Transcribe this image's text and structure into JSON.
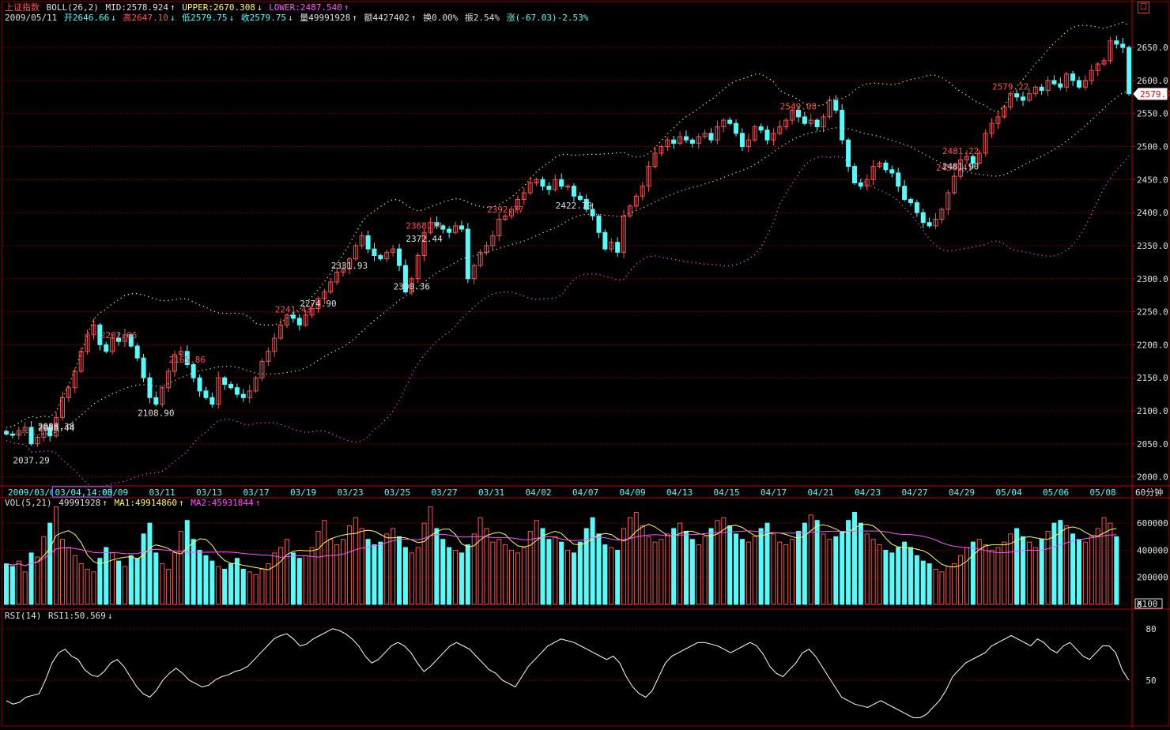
{
  "header": {
    "index_name": "上证指数",
    "indicator": "BOLL(26,2)",
    "mid": "MID:2578.924",
    "upper": "UPPER:2670.308",
    "lower": "LOWER:2487.540",
    "date": "2009/05/11",
    "open": "开2646.66",
    "high": "高2647.10",
    "low": "低2579.75",
    "close": "收2579.75",
    "volume": "量49991928",
    "amount": "额4427402",
    "turnover": "换0.00%",
    "amplitude": "振2.54%",
    "change": "涨(-67.03)-2.53%",
    "icon": "restore-icon"
  },
  "price_panel": {
    "y_ticks": [
      "2650.0",
      "2600.0",
      "2550.0",
      "2500.0",
      "2450.0",
      "2400.0",
      "2350.0",
      "2300.0",
      "2250.0",
      "2200.0",
      "2150.0",
      "2100.0",
      "2050.0",
      "2000.0"
    ],
    "last_price_tag": "2579.7",
    "period": "60分钟"
  },
  "x_axis": {
    "labels": [
      "2009/03/02",
      "03/04,14:00",
      "03/09",
      "03/11",
      "03/13",
      "03/17",
      "03/19",
      "03/23",
      "03/25",
      "03/27",
      "03/31",
      "04/02",
      "04/07",
      "04/09",
      "04/13",
      "04/15",
      "04/17",
      "04/21",
      "04/23",
      "04/27",
      "04/29",
      "05/04",
      "05/06",
      "05/08"
    ]
  },
  "volume_panel": {
    "name": "VOL(5,21)",
    "value": "49991928",
    "ma1": "MA1:49914860",
    "ma2": "MA2:45931844",
    "y_ticks": [
      "600000",
      "400000",
      "200000",
      "0"
    ],
    "unit": "X100"
  },
  "rsi_panel": {
    "name": "RSI(14)",
    "value": "RSI1:50.569",
    "y_ticks": [
      "80",
      "50"
    ]
  },
  "colors": {
    "up": "#ff5050",
    "down": "#54fcfc",
    "upper": "#ffff54",
    "mid": "#e0e0e0",
    "lower": "#ff54ff",
    "grid": "#8b0000",
    "rsi": "#ffffff"
  },
  "chart_data": [
    {
      "type": "candlestick",
      "title": "上证指数 60分钟",
      "annotations": [
        {
          "text": "2037.29",
          "kind": "low",
          "value": 2037.29
        },
        {
          "text": "2241.43",
          "kind": "high",
          "value": 2241.43
        },
        {
          "text": "2088.38",
          "kind": "low",
          "value": 2088.38
        },
        {
          "text": "2202.66",
          "kind": "high",
          "value": 2202.66
        },
        {
          "text": "2086.44",
          "kind": "low",
          "value": 2086.44
        },
        {
          "text": "2165.86",
          "kind": "high",
          "value": 2165.86
        },
        {
          "text": "2108.90",
          "kind": "low",
          "value": 2108.9
        },
        {
          "text": "2368.74",
          "kind": "high",
          "value": 2368.74
        },
        {
          "text": "2274.90",
          "kind": "low",
          "value": 2274.9
        },
        {
          "text": "2392.77",
          "kind": "high",
          "value": 2392.77
        },
        {
          "text": "2300.36",
          "kind": "low",
          "value": 2300.36
        },
        {
          "text": "2456.41",
          "kind": "high",
          "value": 2456.41
        },
        {
          "text": "2331.93",
          "kind": "low",
          "value": 2331.93
        },
        {
          "text": "2549.08",
          "kind": "high",
          "value": 2549.08
        },
        {
          "text": "2481.90",
          "kind": "low",
          "value": 2481.9
        },
        {
          "text": "2579.22",
          "kind": "high",
          "value": 2579.22
        },
        {
          "text": "2422.79",
          "kind": "low",
          "value": 2422.79
        },
        {
          "text": "2481.22",
          "kind": "high",
          "value": 2481.22
        },
        {
          "text": "2372.44",
          "kind": "low",
          "value": 2372.44
        }
      ],
      "close_path": [
        2065,
        2063,
        2070,
        2075,
        2050,
        2060,
        2075,
        2062,
        2090,
        2120,
        2135,
        2160,
        2190,
        2215,
        2230,
        2200,
        2190,
        2210,
        2205,
        2215,
        2198,
        2180,
        2150,
        2120,
        2110,
        2135,
        2160,
        2185,
        2190,
        2170,
        2150,
        2130,
        2120,
        2110,
        2150,
        2140,
        2135,
        2125,
        2120,
        2130,
        2150,
        2175,
        2190,
        2210,
        2230,
        2245,
        2240,
        2230,
        2245,
        2255,
        2270,
        2280,
        2295,
        2310,
        2315,
        2330,
        2350,
        2365,
        2345,
        2335,
        2330,
        2340,
        2345,
        2320,
        2280,
        2300,
        2335,
        2370,
        2385,
        2380,
        2375,
        2370,
        2380,
        2375,
        2300,
        2320,
        2340,
        2350,
        2365,
        2390,
        2395,
        2405,
        2420,
        2430,
        2445,
        2450,
        2440,
        2435,
        2450,
        2440,
        2440,
        2425,
        2420,
        2405,
        2395,
        2370,
        2345,
        2355,
        2340,
        2395,
        2410,
        2425,
        2440,
        2470,
        2490,
        2500,
        2510,
        2505,
        2515,
        2510,
        2505,
        2515,
        2520,
        2510,
        2530,
        2540,
        2535,
        2520,
        2500,
        2510,
        2530,
        2525,
        2510,
        2520,
        2530,
        2540,
        2555,
        2545,
        2535,
        2540,
        2530,
        2545,
        2570,
        2555,
        2510,
        2470,
        2445,
        2440,
        2450,
        2470,
        2475,
        2465,
        2460,
        2440,
        2420,
        2415,
        2400,
        2385,
        2380,
        2390,
        2405,
        2430,
        2455,
        2480,
        2485,
        2475,
        2490,
        2520,
        2535,
        2545,
        2560,
        2580,
        2575,
        2570,
        2580,
        2590,
        2585,
        2600,
        2595,
        2590,
        2610,
        2600,
        2590,
        2600,
        2615,
        2625,
        2630,
        2660,
        2655,
        2650,
        2580
      ]
    },
    {
      "type": "bar",
      "title": "VOL(5,21)",
      "volume_pattern": [
        300,
        280,
        320,
        240,
        380,
        350,
        500,
        600,
        720,
        480,
        420,
        360,
        300,
        260,
        240,
        340,
        420,
        380,
        320,
        280,
        360,
        340,
        520,
        600,
        380,
        300,
        260,
        380,
        540,
        620,
        480,
        400,
        360,
        320,
        280,
        260,
        300,
        340,
        260,
        240,
        220,
        260,
        300,
        380,
        420,
        480,
        380,
        340,
        360,
        420,
        540,
        620,
        480,
        440,
        480,
        580,
        640,
        560,
        480,
        440,
        460,
        520,
        560,
        500,
        420,
        380,
        420,
        600,
        720,
        560,
        480,
        420,
        400,
        380,
        440,
        520,
        640,
        560,
        460,
        480,
        440,
        400,
        380,
        420,
        540,
        620,
        560,
        480,
        500,
        460,
        400,
        380,
        460,
        560,
        640,
        520,
        440,
        420,
        400,
        560,
        640,
        680,
        580,
        500,
        460,
        480,
        520,
        560,
        600,
        540,
        480,
        440,
        500,
        560,
        620,
        640,
        580,
        520,
        480,
        460,
        500,
        560,
        600,
        520,
        460,
        440,
        480,
        540,
        600,
        660,
        620,
        520,
        480,
        500,
        540,
        620,
        680,
        600,
        520,
        480,
        440,
        400,
        380,
        420,
        460,
        420,
        360,
        320,
        300,
        260,
        240,
        280,
        300,
        360,
        420,
        460,
        480,
        440,
        400,
        420,
        460,
        520,
        560,
        500,
        460,
        420,
        480,
        540,
        600,
        620,
        580,
        520,
        480,
        460,
        500,
        560,
        640,
        600,
        500
      ],
      "ylim": [
        0,
        700000
      ]
    },
    {
      "type": "line",
      "title": "RSI(14)",
      "values": [
        38,
        36,
        37,
        40,
        41,
        42,
        50,
        60,
        66,
        68,
        64,
        62,
        56,
        53,
        52,
        55,
        60,
        62,
        58,
        52,
        46,
        42,
        40,
        44,
        50,
        54,
        57,
        54,
        50,
        48,
        46,
        47,
        50,
        52,
        53,
        55,
        56,
        58,
        62,
        66,
        70,
        74,
        76,
        77,
        74,
        70,
        71,
        74,
        76,
        78,
        80,
        79,
        77,
        74,
        70,
        64,
        60,
        62,
        66,
        70,
        72,
        70,
        66,
        60,
        55,
        58,
        62,
        66,
        70,
        72,
        70,
        68,
        64,
        60,
        56,
        54,
        50,
        48,
        46,
        52,
        58,
        62,
        66,
        70,
        72,
        74,
        73,
        72,
        70,
        68,
        66,
        64,
        62,
        64,
        60,
        52,
        46,
        42,
        40,
        44,
        52,
        60,
        64,
        66,
        68,
        70,
        72,
        72,
        71,
        70,
        68,
        66,
        68,
        70,
        72,
        70,
        65,
        58,
        54,
        52,
        56,
        60,
        66,
        68,
        64,
        58,
        52,
        46,
        40,
        38,
        36,
        35,
        34,
        36,
        38,
        36,
        34,
        32,
        30,
        28,
        28,
        30,
        34,
        38,
        44,
        52,
        56,
        60,
        62,
        64,
        66,
        70,
        72,
        74,
        76,
        74,
        72,
        70,
        74,
        72,
        68,
        66,
        70,
        72,
        68,
        64,
        62,
        66,
        70,
        70,
        66,
        56,
        50
      ]
    }
  ]
}
